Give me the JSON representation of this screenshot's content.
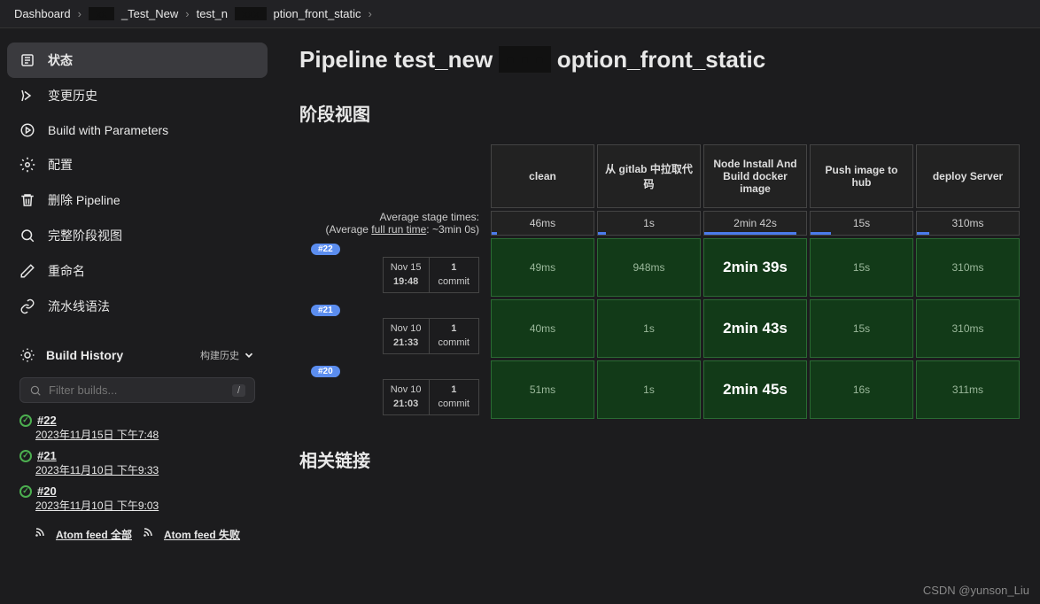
{
  "breadcrumb": [
    "Dashboard",
    "_Test_New",
    "test_n",
    "ption_front_static"
  ],
  "page_title_prefix": "Pipeline test_new",
  "page_title_suffix": "option_front_static",
  "nav": [
    {
      "icon": "status",
      "label": "状态",
      "active": true
    },
    {
      "icon": "history",
      "label": "变更历史"
    },
    {
      "icon": "play",
      "label": "Build with Parameters"
    },
    {
      "icon": "gear",
      "label": "配置"
    },
    {
      "icon": "trash",
      "label": "删除 Pipeline"
    },
    {
      "icon": "search",
      "label": "完整阶段视图"
    },
    {
      "icon": "edit",
      "label": "重命名"
    },
    {
      "icon": "link",
      "label": "流水线语法"
    }
  ],
  "build_history": {
    "title": "Build History",
    "subtitle": "构建历史",
    "search_placeholder": "Filter builds...",
    "items": [
      {
        "id": "#22",
        "date": "2023年11月15日 下午7:48"
      },
      {
        "id": "#21",
        "date": "2023年11月10日 下午9:33"
      },
      {
        "id": "#20",
        "date": "2023年11月10日 下午9:03"
      }
    ],
    "feed_all": "Atom feed 全部",
    "feed_fail": "Atom feed 失败"
  },
  "stage_view": {
    "title": "阶段视图",
    "avg_label_1": "Average stage times:",
    "avg_label_2a": "(Average ",
    "avg_label_2b": "full run time",
    "avg_label_2c": ": ~3min 0s)",
    "headers": [
      "clean",
      "从 gitlab 中拉取代码",
      "Node Install And Build docker image",
      "Push image to hub",
      "deploy Server"
    ],
    "averages": [
      "46ms",
      "1s",
      "2min 42s",
      "15s",
      "310ms"
    ],
    "runs": [
      {
        "id": "#22",
        "date": "Nov 15",
        "time": "19:48",
        "commits": "1",
        "commits_label": "commit",
        "cells": [
          "49ms",
          "948ms",
          "2min 39s",
          "15s",
          "310ms"
        ]
      },
      {
        "id": "#21",
        "date": "Nov 10",
        "time": "21:33",
        "commits": "1",
        "commits_label": "commit",
        "cells": [
          "40ms",
          "1s",
          "2min 43s",
          "15s",
          "310ms"
        ]
      },
      {
        "id": "#20",
        "date": "Nov 10",
        "time": "21:03",
        "commits": "1",
        "commits_label": "commit",
        "cells": [
          "51ms",
          "1s",
          "2min 45s",
          "16s",
          "311ms"
        ]
      }
    ]
  },
  "related_title": "相关链接",
  "watermark": "CSDN @yunson_Liu"
}
